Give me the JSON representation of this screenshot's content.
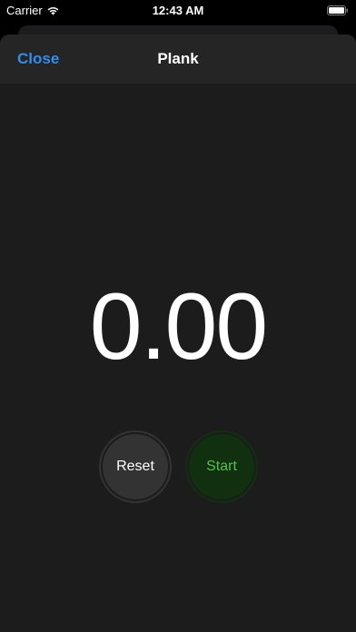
{
  "status_bar": {
    "carrier": "Carrier",
    "time": "12:43 AM",
    "wifi_icon": "wifi-icon",
    "battery_icon": "battery-icon"
  },
  "nav": {
    "close_label": "Close",
    "title": "Plank"
  },
  "timer": {
    "display": "0.00"
  },
  "controls": {
    "reset_label": "Reset",
    "start_label": "Start"
  },
  "colors": {
    "accent_blue": "#2f8ff0",
    "start_green": "#53c04d",
    "start_bg": "#10300f",
    "reset_bg": "#333333",
    "sheet_bg": "#1c1c1c",
    "nav_bg": "#252525"
  }
}
